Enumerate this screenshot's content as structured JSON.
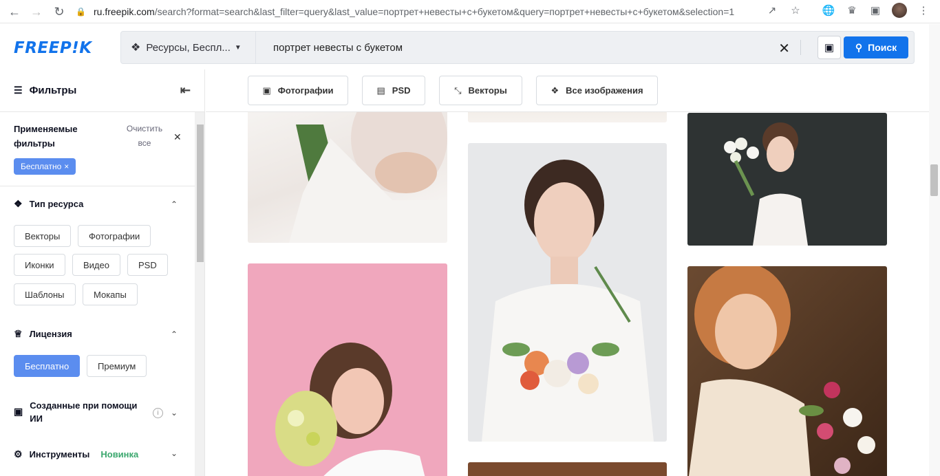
{
  "browser": {
    "url_host": "ru.freepik.com",
    "url_rest": "/search?format=search&last_filter=query&last_value=портрет+невесты+с+букетом&query=портрет+невесты+с+букетом&selection=1"
  },
  "header": {
    "logo": "FREEP!K",
    "resource_select": "Ресурсы, Беспл...",
    "query": "портрет невесты с букетом",
    "search_button": "Поиск"
  },
  "sidebar": {
    "title": "Фильтры",
    "applied_label": "Применяемые фильтры",
    "clear_all": "Очистить все",
    "applied_chip": "Бесплатно",
    "resource_type": {
      "title": "Тип ресурса",
      "options": [
        "Векторы",
        "Фотографии",
        "Иконки",
        "Видео",
        "PSD",
        "Шаблоны",
        "Мокапы"
      ]
    },
    "license": {
      "title": "Лицензия",
      "options": [
        "Бесплатно",
        "Премиум"
      ]
    },
    "ai_section": "Созданные при помощи ИИ",
    "tools_section": "Инструменты",
    "tools_badge": "Новинка"
  },
  "tabs": [
    "Фотографии",
    "PSD",
    "Векторы",
    "Все изображения"
  ]
}
